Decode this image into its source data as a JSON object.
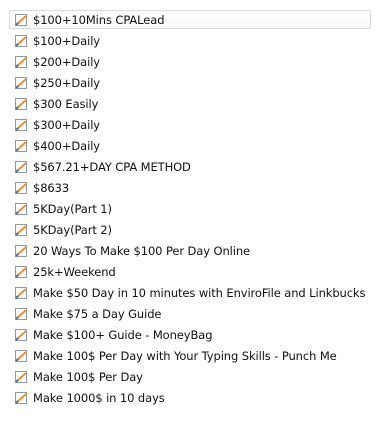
{
  "file_list": {
    "items": [
      {
        "label": "$100+10Mins CPALead",
        "icon": "document-icon",
        "selected": true
      },
      {
        "label": "$100+Daily",
        "icon": "document-icon"
      },
      {
        "label": "$200+Daily",
        "icon": "document-icon"
      },
      {
        "label": "$250+Daily",
        "icon": "document-icon"
      },
      {
        "label": "$300 Easily",
        "icon": "document-icon"
      },
      {
        "label": "$300+Daily",
        "icon": "document-icon"
      },
      {
        "label": "$400+Daily",
        "icon": "document-icon"
      },
      {
        "label": "$567.21+DAY CPA METHOD",
        "icon": "document-icon"
      },
      {
        "label": "$8633",
        "icon": "document-icon"
      },
      {
        "label": "5KDay(Part 1)",
        "icon": "document-icon"
      },
      {
        "label": "5KDay(Part 2)",
        "icon": "document-icon"
      },
      {
        "label": "20 Ways To Make $100 Per Day Online",
        "icon": "document-icon"
      },
      {
        "label": "25k+Weekend",
        "icon": "document-icon"
      },
      {
        "label": "Make $50 Day in 10 minutes with EnviroFile and Linkbucks",
        "icon": "document-icon"
      },
      {
        "label": "Make $75 a Day Guide",
        "icon": "document-icon"
      },
      {
        "label": "Make $100+ Guide - MoneyBag",
        "icon": "document-icon"
      },
      {
        "label": "Make 100$ Per Day with Your Typing Skills - Punch Me",
        "icon": "document-icon"
      },
      {
        "label": "Make 100$ Per Day",
        "icon": "document-icon"
      },
      {
        "label": "Make 1000$ in 10 days",
        "icon": "document-icon"
      }
    ]
  },
  "colors": {
    "selection_border": "#dadada",
    "icon_orange": "#f28c28",
    "icon_blue": "#3f6fbf"
  }
}
